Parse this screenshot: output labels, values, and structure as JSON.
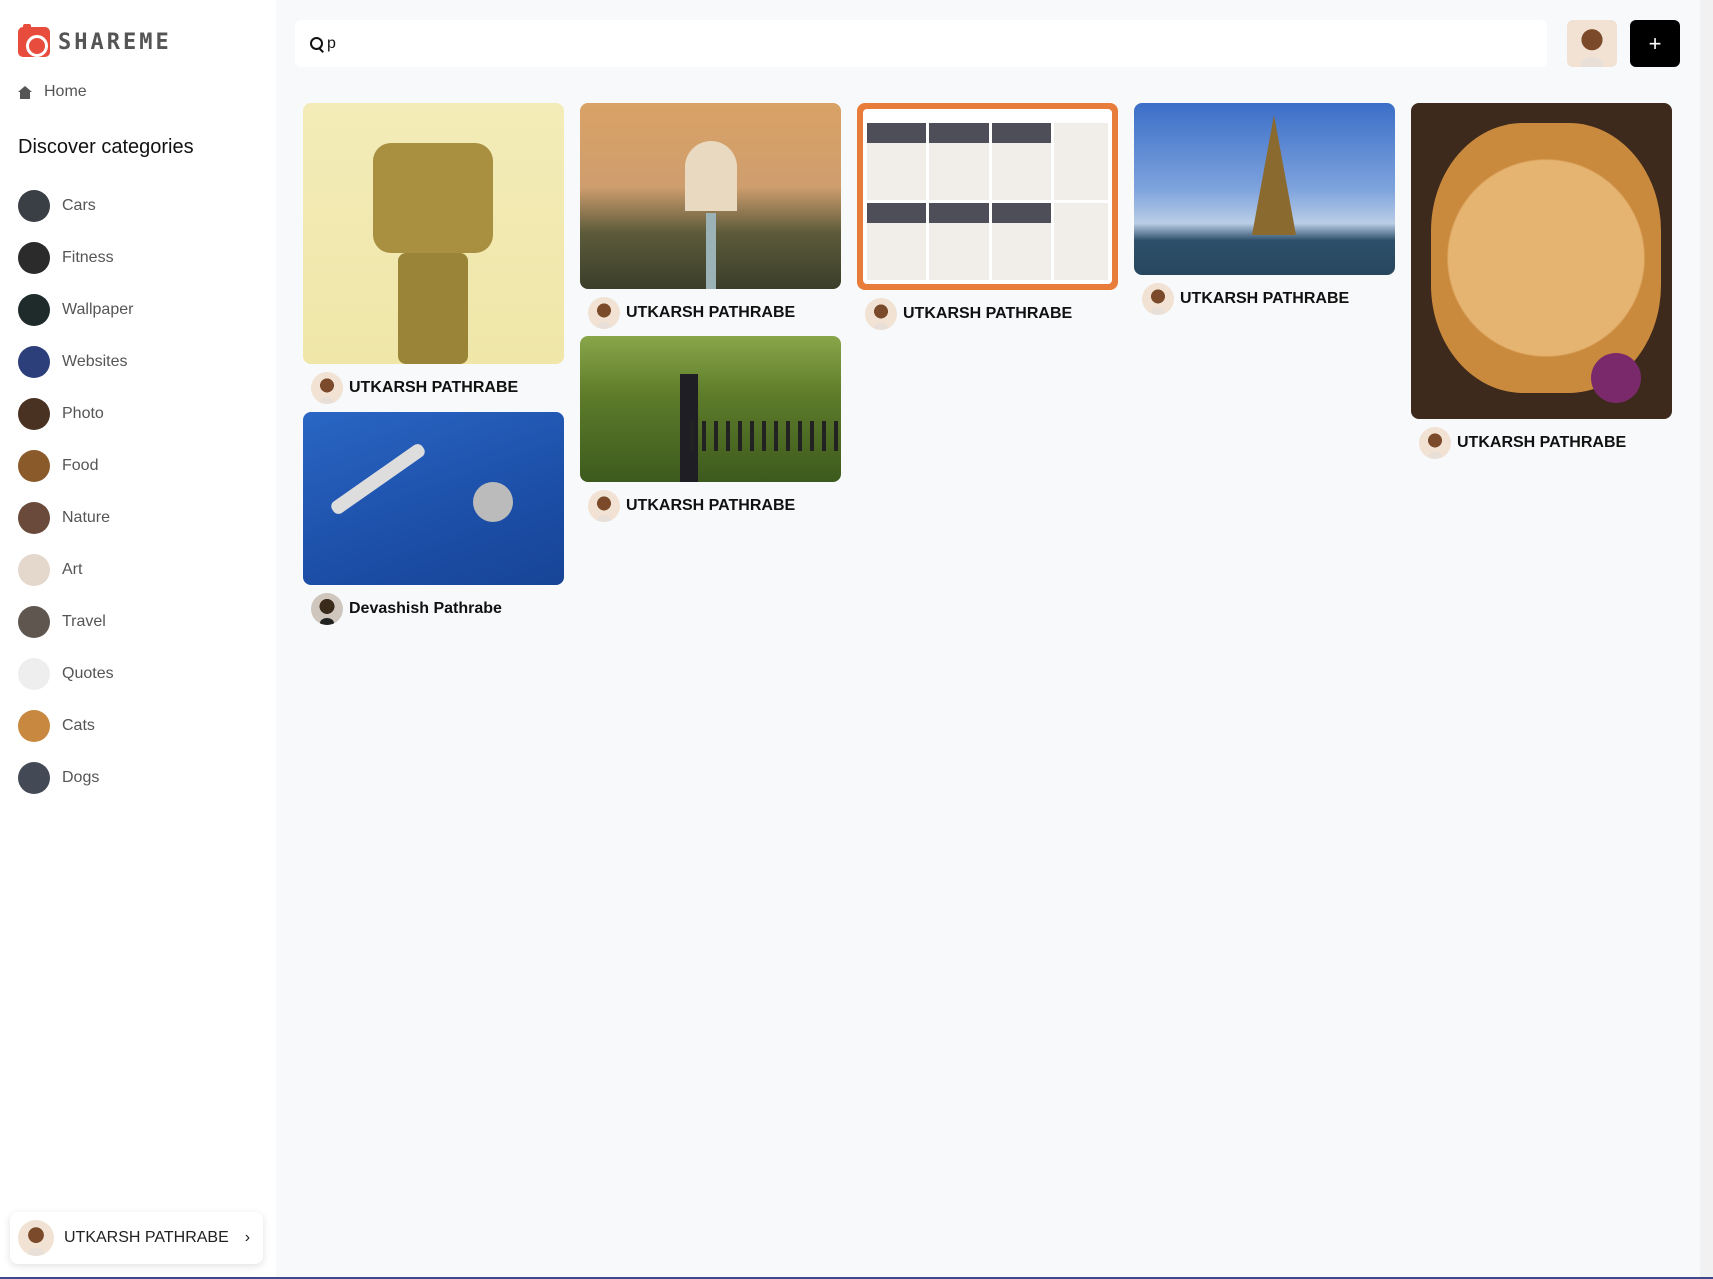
{
  "app": {
    "logo_text": "SHAREME"
  },
  "sidebar": {
    "home_label": "Home",
    "categories_heading": "Discover categories",
    "categories": [
      {
        "label": "Cars",
        "color": "#3a3f45"
      },
      {
        "label": "Fitness",
        "color": "#2b2b2b"
      },
      {
        "label": "Wallpaper",
        "color": "#1f2a2a"
      },
      {
        "label": "Websites",
        "color": "#2c3f7a"
      },
      {
        "label": "Photo",
        "color": "#4a3222"
      },
      {
        "label": "Food",
        "color": "#8a5a2a"
      },
      {
        "label": "Nature",
        "color": "#6a4a3a"
      },
      {
        "label": "Art",
        "color": "#e4d7cc"
      },
      {
        "label": "Travel",
        "color": "#5f5650"
      },
      {
        "label": "Quotes",
        "color": "#eeeeee"
      },
      {
        "label": "Cats",
        "color": "#c9883f"
      },
      {
        "label": "Dogs",
        "color": "#444a55"
      }
    ],
    "user": {
      "name": "UTKARSH PATHRABE",
      "chevron": "›"
    }
  },
  "topbar": {
    "search_value": "p",
    "add_label": "+"
  },
  "pins": [
    {
      "author": "UTKARSH PATHRABE"
    },
    {
      "author": "Devashish Pathrabe"
    },
    {
      "author": "UTKARSH PATHRABE"
    },
    {
      "author": "UTKARSH PATHRABE"
    },
    {
      "author": "UTKARSH PATHRABE"
    },
    {
      "author": "UTKARSH PATHRABE"
    },
    {
      "author": "UTKARSH PATHRABE"
    }
  ]
}
